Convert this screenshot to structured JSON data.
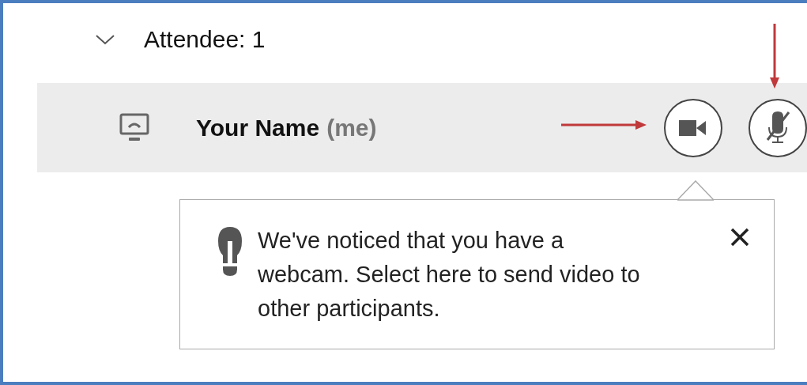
{
  "group": {
    "label": "Attendee: 1",
    "expanded": true
  },
  "attendee": {
    "name": "Your Name",
    "suffix": "(me)",
    "video_on": false,
    "muted": true
  },
  "tooltip": {
    "message_lines": [
      "We've noticed that you have a",
      "webcam. Select here to send video to",
      "other participants."
    ]
  }
}
